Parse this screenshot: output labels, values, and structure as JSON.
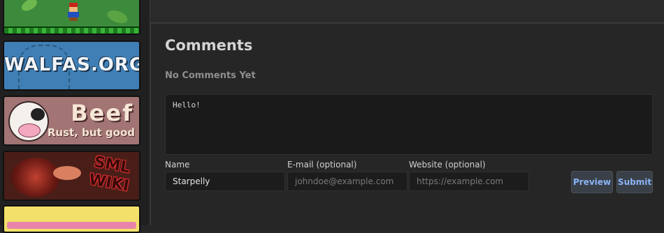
{
  "sidebar": {
    "banners": [
      {
        "name": "mario",
        "text": ""
      },
      {
        "name": "walfas",
        "text": "WALFAS.ORG"
      },
      {
        "name": "beef",
        "title": "Beef",
        "subtitle": "Rust, but good"
      },
      {
        "name": "sml",
        "text": "SML WIKI"
      },
      {
        "name": "yellow",
        "text": ""
      }
    ]
  },
  "comments": {
    "heading": "Comments",
    "status": "No Comments Yet",
    "body": "Hello!",
    "fields": {
      "name_label": "Name",
      "name_value": "Starpelly",
      "email_label": "E-mail (optional)",
      "email_placeholder": "johndoe@example.com",
      "website_label": "Website (optional)",
      "website_placeholder": "https://example.com"
    },
    "buttons": {
      "preview": "Preview",
      "submit": "Submit"
    }
  },
  "colors": {
    "background": "#262626",
    "accent": "#8ab4f8",
    "input_bg": "#1c1c1c"
  }
}
